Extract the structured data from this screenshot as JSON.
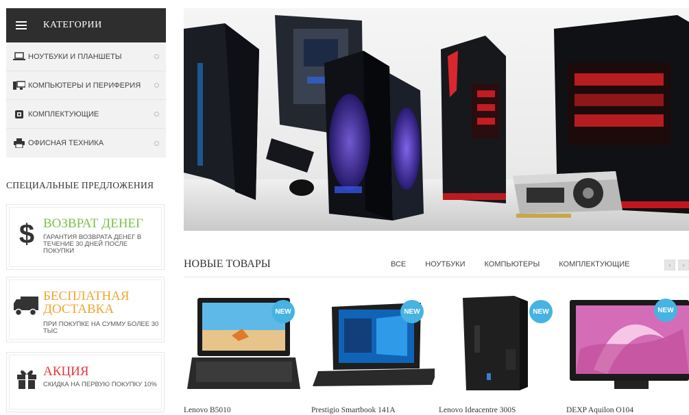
{
  "sidebar": {
    "header_title": "КАТЕГОРИИ",
    "categories": [
      {
        "label": "НОУТБУКИ И ПЛАНШЕТЫ",
        "icon": "laptop-icon"
      },
      {
        "label": "КОМПЬЮТЕРЫ И ПЕРИФЕРИЯ",
        "icon": "desktop-icon"
      },
      {
        "label": "КОМПЛЕКТУЮЩИЕ",
        "icon": "chip-icon"
      },
      {
        "label": "ОФИСНАЯ ТЕХНИКА",
        "icon": "printer-icon"
      }
    ],
    "offers_title": "СПЕЦИАЛЬНЫЕ ПРЕДЛОЖЕНИЯ",
    "offers": [
      {
        "title": "ВОЗВРАТ ДЕНЕГ",
        "text": "ГАРАНТИЯ ВОЗВРАТА ДЕНЕГ В ТЕЧЕНИЕ 30 ДНЕЙ ПОСЛЕ ПОКУПКИ",
        "icon": "dollar-icon",
        "color": "#7cc04b"
      },
      {
        "title": "БЕСПЛАТНАЯ ДОСТАВКА",
        "text": "ПРИ ПОКУПКЕ НА СУММУ БОЛЕЕ 30 ТЫС",
        "icon": "truck-icon",
        "color": "#f2a431"
      },
      {
        "title": "АКЦИЯ",
        "text": "СКИДКА НА ПЕРВУЮ ПОКУПКУ 10%",
        "icon": "gift-icon",
        "color": "#e4373d"
      }
    ]
  },
  "new_products": {
    "title": "НОВЫЕ ТОВАРЫ",
    "filters": [
      "ВСЕ",
      "НОУТБУКИ",
      "КОМПЬЮТЕРЫ",
      "КОМПЛЕКТУЮЩИЕ"
    ],
    "badge": "NEW",
    "items": [
      {
        "name": "Lenovo B5010"
      },
      {
        "name": "Prestigio Smartbook 141A"
      },
      {
        "name": "Lenovo Ideacentre 300S"
      },
      {
        "name": "DEXP Aquilon O104"
      }
    ]
  },
  "colors": {
    "badge": "#46b3e3",
    "header_bg": "#2e2e2e"
  }
}
